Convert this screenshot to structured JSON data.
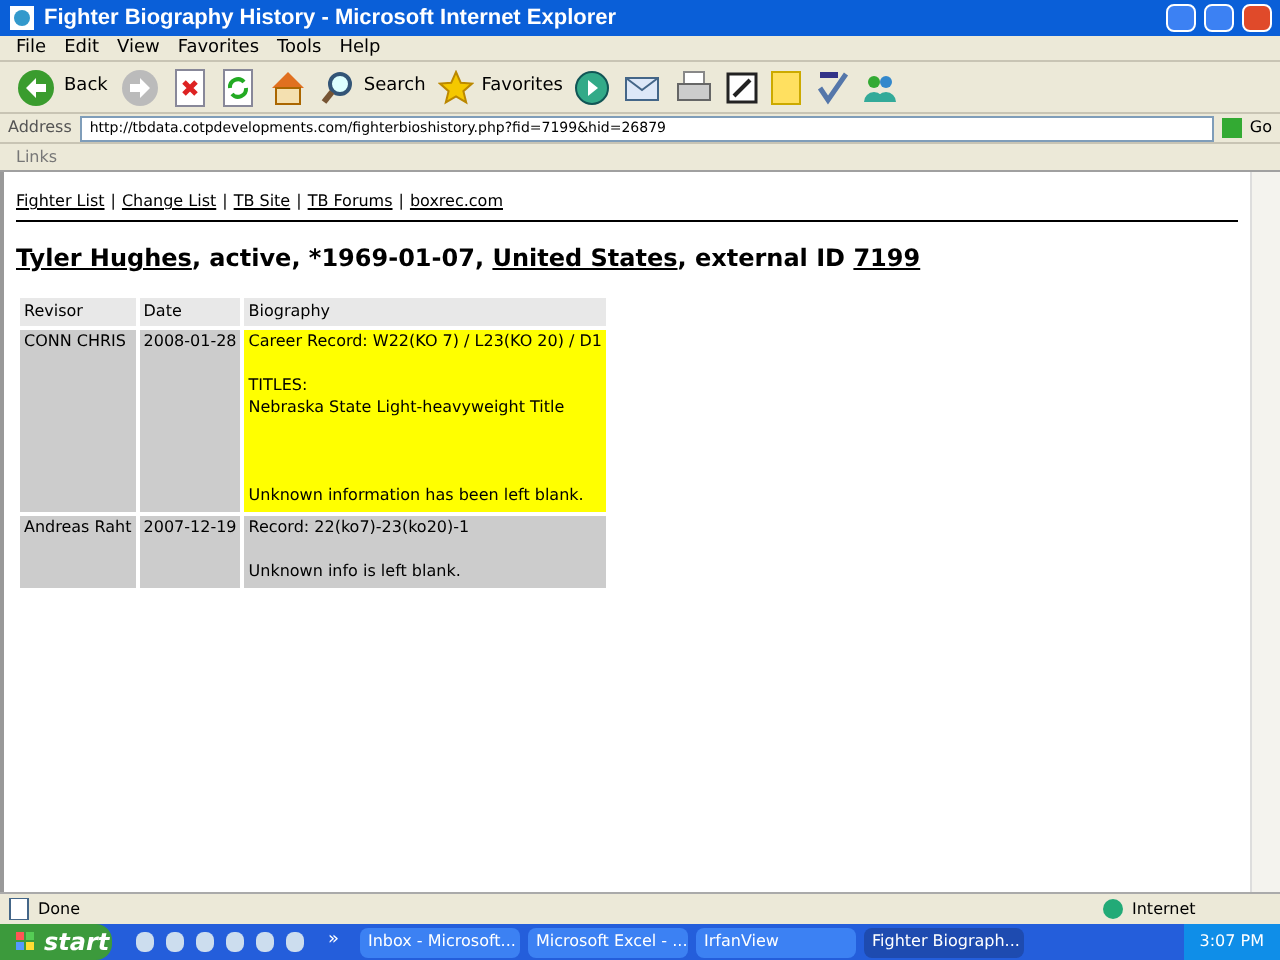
{
  "window": {
    "title": "Fighter Biography History - Microsoft Internet Explorer"
  },
  "menu": [
    "File",
    "Edit",
    "View",
    "Favorites",
    "Tools",
    "Help"
  ],
  "toolbar": [
    {
      "kind": "back",
      "label": "Back"
    },
    {
      "kind": "forward"
    },
    {
      "kind": "stop"
    },
    {
      "kind": "refresh"
    },
    {
      "kind": "home"
    },
    {
      "kind": "search",
      "label": "Search"
    },
    {
      "kind": "favorites",
      "label": "Favorites"
    },
    {
      "kind": "media"
    },
    {
      "kind": "mail"
    },
    {
      "kind": "print"
    },
    {
      "kind": "edit"
    },
    {
      "kind": "note"
    },
    {
      "kind": "spell"
    },
    {
      "kind": "messenger"
    }
  ],
  "address": {
    "label": "Address",
    "value": "http://tbdata.cotpdevelopments.com/fighterbioshistory.php?fid=7199&hid=26879",
    "go": "Go"
  },
  "links_bar": "Links",
  "nav_links": [
    "Fighter List",
    "Change List",
    "TB Site",
    "TB Forums",
    "boxrec.com"
  ],
  "nav_separator": "|",
  "heading": [
    {
      "text": "Tyler Hughes",
      "link": true
    },
    {
      "text": ", active, *1969-01-07, ",
      "link": false
    },
    {
      "text": "United States",
      "link": true
    },
    {
      "text": ", external ID ",
      "link": false
    },
    {
      "text": "7199",
      "link": true
    }
  ],
  "table": {
    "columns": [
      "Revisor",
      "Date",
      "Biography"
    ],
    "rows": [
      {
        "revisor": "CONN CHRIS",
        "date": "2008-01-28",
        "highlighted": true,
        "biography": [
          [
            "Career Record: W22(KO 7) / L23(KO 20) / D1"
          ],
          [
            "TITLES:",
            "Nebraska State Light-heavyweight Title"
          ],
          [
            "Unknown information has been left blank."
          ]
        ]
      },
      {
        "revisor": "Andreas Raht",
        "date": "2007-12-19",
        "highlighted": false,
        "biography": [
          [
            "Record: 22(ko7)-23(ko20)-1"
          ],
          [
            "Unknown info is left blank."
          ]
        ]
      }
    ]
  },
  "status_bar": {
    "text": "Done",
    "zone": "Internet"
  },
  "taskbar": {
    "start": "start",
    "tasks": [
      {
        "label": "Inbox - Microsoft...",
        "active": false
      },
      {
        "label": "Microsoft Excel - ...",
        "active": false
      },
      {
        "label": "IrfanView",
        "active": false
      },
      {
        "label": "Fighter Biograph...",
        "active": true
      }
    ],
    "overflow": "»",
    "clock": "3:07 PM"
  }
}
